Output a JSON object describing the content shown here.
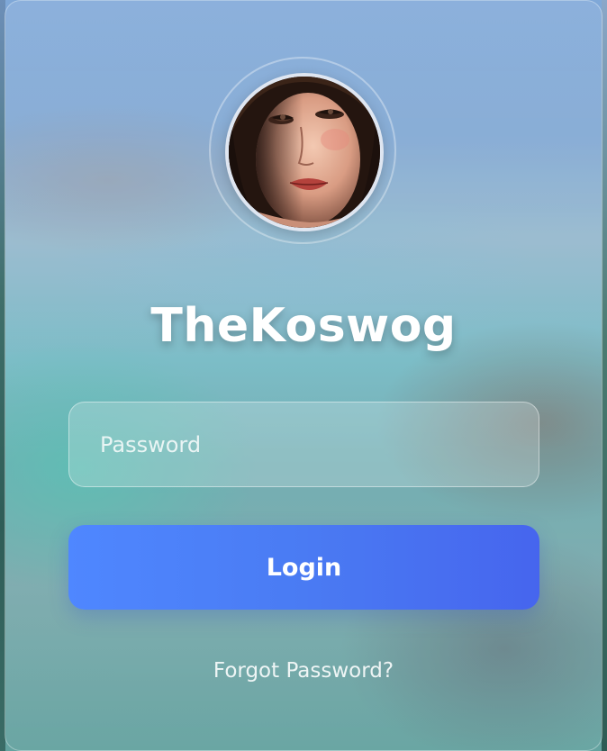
{
  "profile": {
    "username": "TheKoswog",
    "avatar_icon": "user-portrait"
  },
  "form": {
    "password_placeholder": "Password",
    "password_value": "",
    "login_label": "Login",
    "forgot_label": "Forgot Password?"
  },
  "colors": {
    "button_start": "#4f87ff",
    "button_end": "#4665ee",
    "text": "#ffffff"
  }
}
